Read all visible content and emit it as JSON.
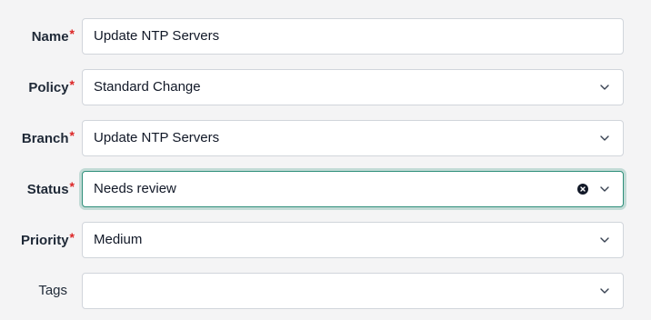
{
  "form": {
    "name": {
      "label": "Name",
      "required_mark": "*",
      "value": "Update NTP Servers"
    },
    "policy": {
      "label": "Policy",
      "required_mark": "*",
      "value": "Standard Change"
    },
    "branch": {
      "label": "Branch",
      "required_mark": "*",
      "value": "Update NTP Servers"
    },
    "status": {
      "label": "Status",
      "required_mark": "*",
      "value": "Needs review"
    },
    "priority": {
      "label": "Priority",
      "required_mark": "*",
      "value": "Medium"
    },
    "tags": {
      "label": "Tags",
      "value": ""
    }
  },
  "icons": {
    "dropdown": "chevron-down-icon",
    "clear": "clear-icon"
  },
  "colors": {
    "required": "#dc2626",
    "focus_border": "#2f8f7a"
  }
}
